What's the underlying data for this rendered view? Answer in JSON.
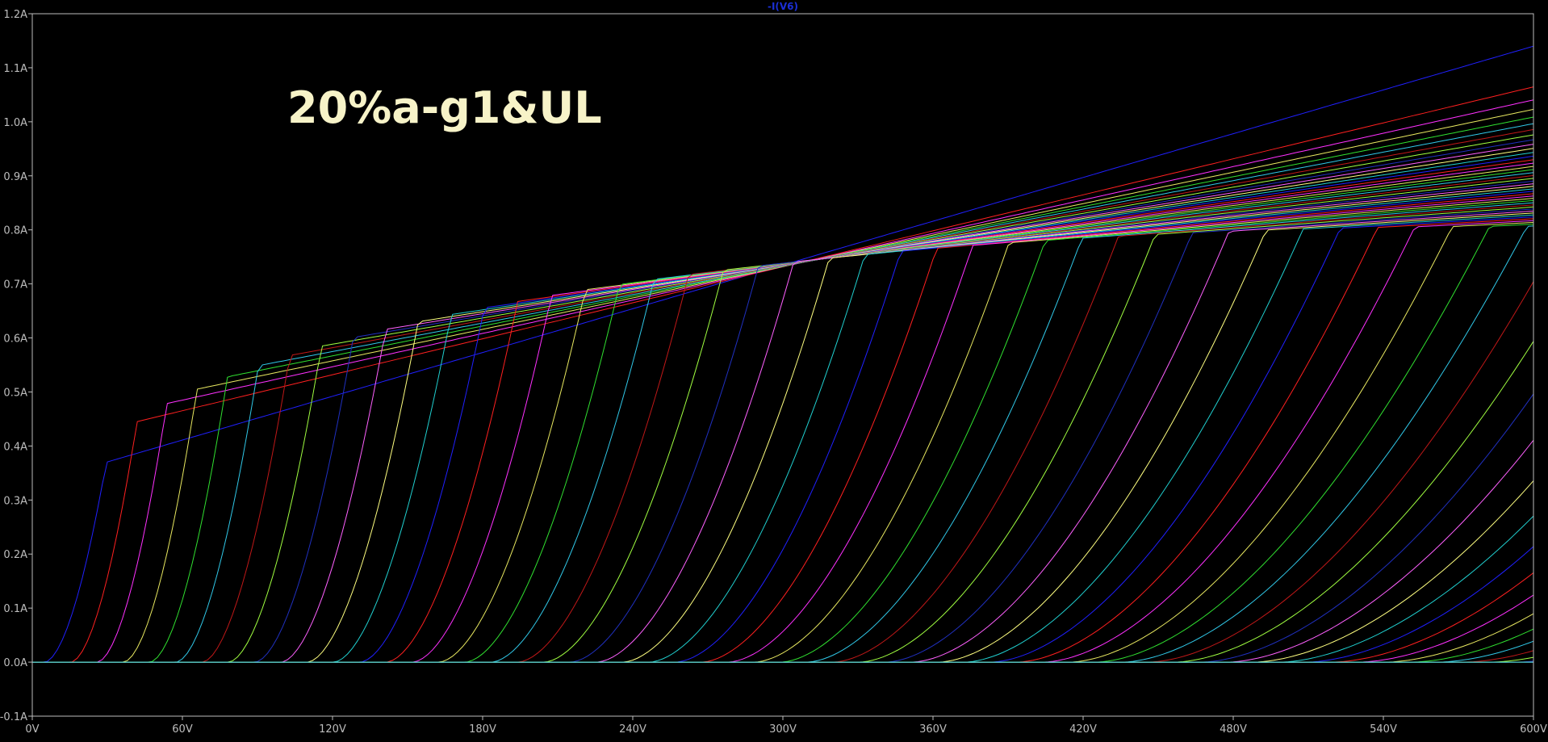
{
  "chart_data": {
    "type": "line",
    "title": "-I(V6)",
    "annotation": "20%a-g1&UL",
    "xlabel": "",
    "ylabel": "",
    "xlim": [
      0,
      600
    ],
    "ylim": [
      -0.1,
      1.2
    ],
    "x_ticks": [
      "0V",
      "60V",
      "120V",
      "180V",
      "240V",
      "300V",
      "360V",
      "420V",
      "480V",
      "540V",
      "600V"
    ],
    "y_ticks": [
      "-0.1A",
      "0.0A",
      "0.1A",
      "0.2A",
      "0.3A",
      "0.4A",
      "0.5A",
      "0.6A",
      "0.7A",
      "0.8A",
      "0.9A",
      "1.0A",
      "1.1A",
      "1.2A"
    ],
    "grid": false,
    "legend": "none",
    "series_count": 60,
    "family": {
      "x_onset_first": 5,
      "x_onset_spacing": 10.5,
      "y_at_600_top": 1.14,
      "y_at_600_knee": 0.755,
      "knee_y_first": 0.465,
      "knee_y_last": 0.745
    },
    "colors": {
      "background": "#000000",
      "frame": "#bdbdbd",
      "tick_text": "#bdbdbd",
      "title": "#1b2fd6",
      "annotation": "#f7f3c8",
      "series_palette": [
        "#2020ff",
        "#ff2020",
        "#ff30ff",
        "#e8e860",
        "#30e030",
        "#30c8e8",
        "#c01818",
        "#a0ff40",
        "#2030c0",
        "#ff60ff",
        "#ffff80",
        "#20d0d0"
      ]
    }
  }
}
